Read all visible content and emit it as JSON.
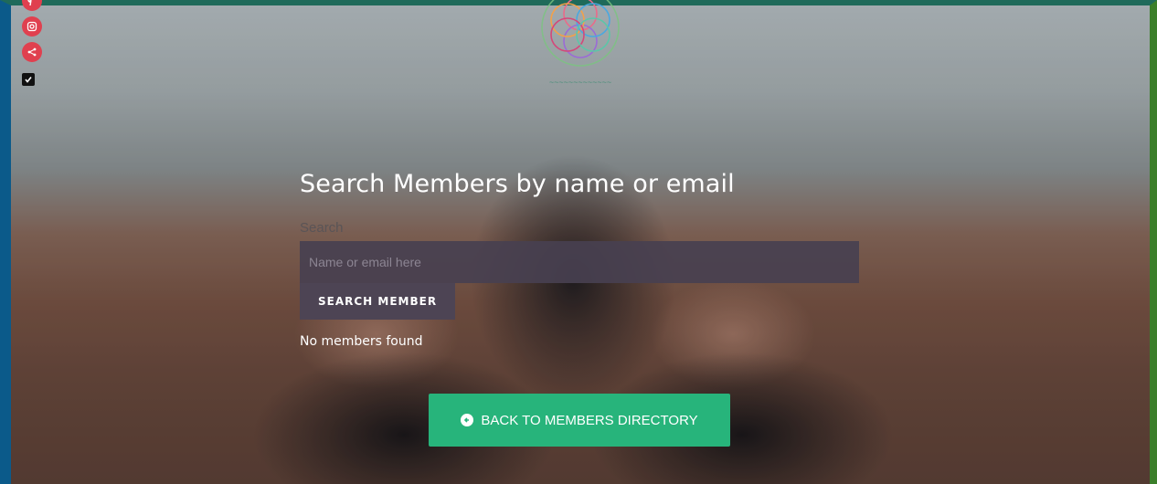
{
  "social": {
    "icons": [
      "pinterest-icon",
      "instagram-icon",
      "share-icon",
      "checkbox-icon"
    ],
    "color": "#e0404f"
  },
  "logo": {
    "icon": "flower-of-life-logo"
  },
  "main": {
    "title": "Search Members by name or email",
    "search_label": "Search",
    "search_placeholder": "Name or email here",
    "search_value": "",
    "search_button": "SEARCH MEMBER",
    "status": "No members found"
  },
  "footer": {
    "back_button": "BACK TO MEMBERS DIRECTORY",
    "back_icon": "arrow-left-circle-icon",
    "accent": "#27b47b"
  }
}
